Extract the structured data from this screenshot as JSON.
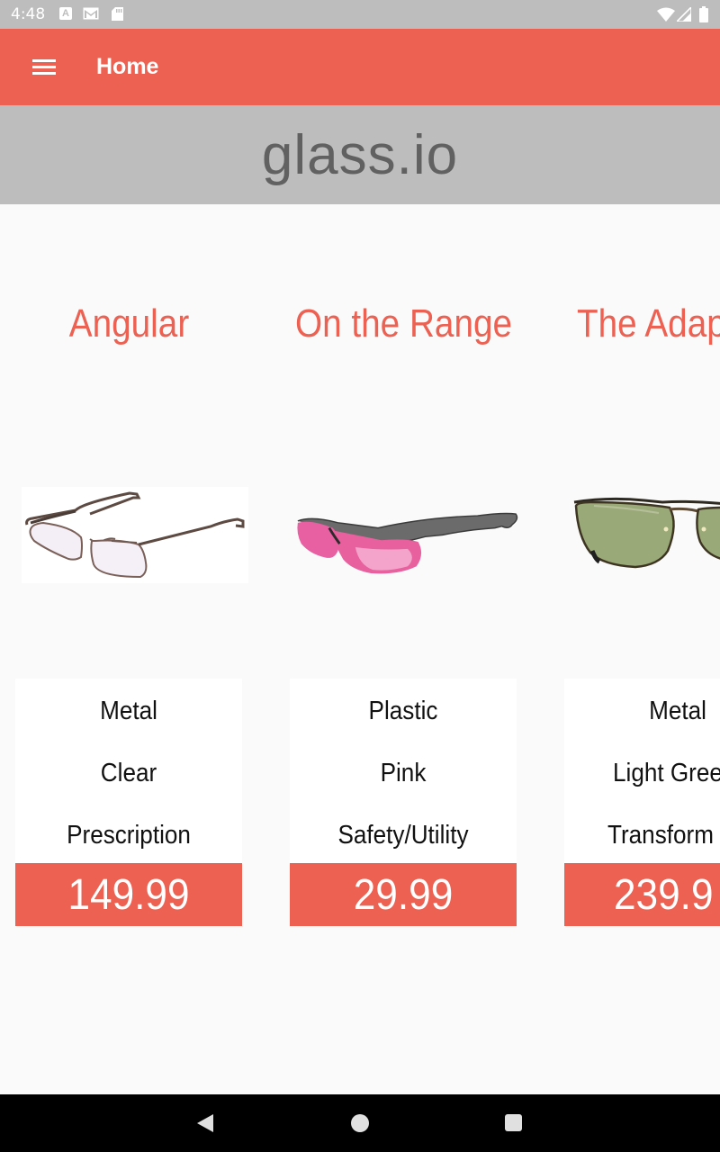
{
  "status_bar": {
    "time": "4:48",
    "icons": [
      "a-notification-icon",
      "gmail-icon",
      "sd-card-icon",
      "wifi-icon",
      "signal-icon",
      "battery-icon"
    ]
  },
  "app_bar": {
    "title": "Home",
    "menu_icon": "menu-icon",
    "color": "#ec6152"
  },
  "banner": {
    "brand": "glass.io"
  },
  "products": [
    {
      "name": "Angular",
      "material": "Metal",
      "lens": "Clear",
      "type": "Prescription",
      "price": "149.99",
      "image": "rimless-prescription-glasses"
    },
    {
      "name": "On the Range",
      "material": "Plastic",
      "lens": "Pink",
      "type": "Safety/Utility",
      "price": "29.99",
      "image": "pink-sport-sunglasses"
    },
    {
      "name": "The Adap",
      "material": "Metal",
      "lens": "Light Gree",
      "type": "Transform",
      "price": "239.9",
      "image": "green-lens-metal-glasses"
    }
  ],
  "nav_bar": {
    "icons": [
      "back-icon",
      "home-icon",
      "recents-icon"
    ]
  }
}
